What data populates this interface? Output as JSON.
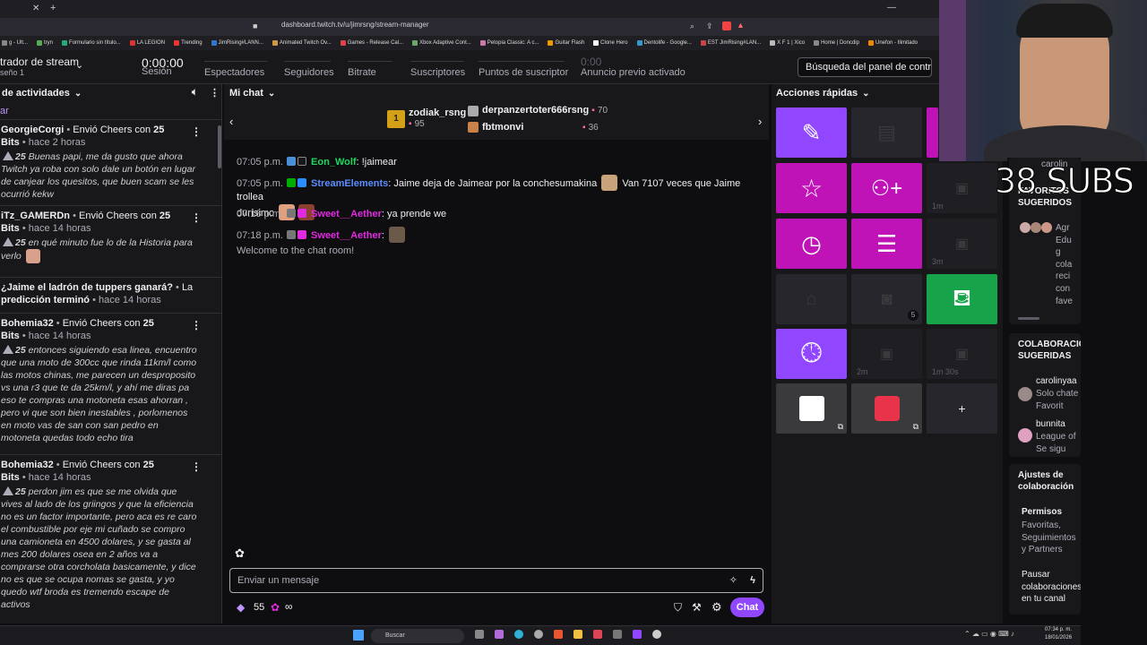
{
  "browser": {
    "url": "dashboard.twitch.tv/u/jimrsng/stream-manager",
    "bookmarks": [
      "g - Ult...",
      "tryn",
      "Formulario sin título...",
      "LA LEGION",
      "Trending",
      "JimRising#LANN...",
      "Animated Twitch Ov...",
      "Games - Release Cal...",
      "Xbox Adaptive Cont...",
      "Petopia Classic: A c...",
      "Guitar Flash",
      "Clone Hero",
      "Dentolife - Google...",
      "EST JimRising#LAN...",
      "X F 1 | Xico",
      "Home | Doncdip",
      "Unefon - Ilimitado"
    ]
  },
  "stats": {
    "title": "trador de stream",
    "subtitle": "seño 1",
    "session_value": "0:00:00",
    "session_label": "Sesión",
    "viewers_label": "Espectadores",
    "followers_label": "Seguidores",
    "bitrate_label": "Bitrate",
    "subs_label": "Suscriptores",
    "points_label": "Puntos de suscriptor",
    "ad_value": "0:00",
    "ad_label": "Anuncio previo activado",
    "search_placeholder": "Búsqueda del panel de contr"
  },
  "activity": {
    "title": "de actividades",
    "filter": "ar",
    "items": [
      {
        "user": "GeorgieCorgi",
        "action": "Envió Cheers con",
        "amount": "25",
        "unit": "Bits",
        "time": "hace 2 horas",
        "bits": "25",
        "msg": "Buenas papi, me da gusto que ahora Twitch ya roba con solo dale un botón en lugar de canjear los quesitos, que buen scam se les ocurrió kekw"
      },
      {
        "user": "iTz_GAMERDn",
        "action": "Envió Cheers con",
        "amount": "25",
        "unit": "Bits",
        "time": "hace 14 horas",
        "bits": "25",
        "msg": "en qué minuto fue lo de la Historia para verlo"
      },
      {
        "prediction_q": "¿Jaime el ladrón de tuppers ganará?",
        "prediction_tail": "La",
        "prediction_done": "predicción",
        "prediction_done2": "terminó",
        "time": "hace 14 horas"
      },
      {
        "user": "Bohemia32",
        "action": "Envió Cheers con",
        "amount": "25",
        "unit": "Bits",
        "time": "hace 14 horas",
        "bits": "25",
        "msg": "entonces siguiendo esa linea, encuentro que una moto de 300cc que rinda 11km/l como las motos chinas, me parecen un desproposito vs una r3 que te da 25km/l, y ahí me diras pa eso te compras una motoneta esas ahorran , pero vi que son bien inestables , porlomenos en moto vas de san con san pedro en motoneta quedas todo echo tira"
      },
      {
        "user": "Bohemia32",
        "action": "Envió Cheers con",
        "amount": "25",
        "unit": "Bits",
        "time": "hace 14 horas",
        "bits": "25",
        "msg": "perdon jim es que se me olvida que vives al lado de los griingos y que la eficiencia no es un factor importante, pero aca es re caro el combustible por eje mi cuñado se compro una camioneta en 4500 dolares, y se gasta al mes 200 dolares osea en 2 años va a comprarse otra corcholata basicamente, y dice no es que se ocupa nomas se gasta, y yo quedo wtf broda es tremendo escape de activos"
      }
    ]
  },
  "chat": {
    "title": "Mi chat",
    "leaderboard": [
      {
        "name": "zodiak_rsng",
        "count": "95"
      },
      {
        "name": "derpanzertoter666rsng",
        "count": "70"
      },
      {
        "name": "fbtmonvi",
        "count": "36"
      }
    ],
    "messages": [
      {
        "time": "07:05 p.m.",
        "user": "Eon_Wolf",
        "text": "!jaimear",
        "color": "#1ed760"
      },
      {
        "time": "07:05 p.m.",
        "user": "StreamElements",
        "text": "Jaime deja de Jaimear por la conchesumakina",
        "text2": "Van 7107 veces que Jaime trollea",
        "text3": "durísimo",
        "color": "#5b8dff"
      },
      {
        "time": "07:18 p.m.",
        "user": "Sweet__Aether",
        "text": "ya prende we",
        "color": "#e02ae0"
      },
      {
        "time": "07:18 p.m.",
        "user": "Sweet__Aether",
        "text": "",
        "color": "#e02ae0"
      }
    ],
    "welcome": "Welcome to the chat room!",
    "input_placeholder": "Enviar un mensaje",
    "points": "55",
    "infinity": "∞",
    "send": "Chat"
  },
  "quick_actions": {
    "title": "Acciones rápidas",
    "cooldowns": {
      "c1": "1m",
      "c2": "3m",
      "c3": "2m",
      "c4": "1m 30s",
      "c5": "5"
    },
    "add": "+"
  },
  "collab": {
    "top_user": "carolin",
    "fav_title": "FAVORITOS SUGERIDOS",
    "fav_text": [
      "Agr",
      "Edu",
      "g",
      "cola",
      "reci",
      "con",
      "fave"
    ],
    "sug_title": "COLABORACIONES SUGERIDAS",
    "users": [
      {
        "name": "carolinyaa",
        "line1": "Solo chate",
        "line2": "Favorit"
      },
      {
        "name": "bunnita",
        "line1": "League of",
        "line2": "Se sigu"
      }
    ],
    "settings_title": "Ajustes de colaboración",
    "perm_title": "Permisos",
    "perm_text": "Favoritas, Seguimientos y Partners",
    "pause_text": "Pausar colaboraciones en tu canal"
  },
  "overlay": {
    "subs": "38 SUBS"
  },
  "taskbar": {
    "search": "Buscar",
    "time": "07:34 p. m.",
    "date": "18/01/2026"
  }
}
